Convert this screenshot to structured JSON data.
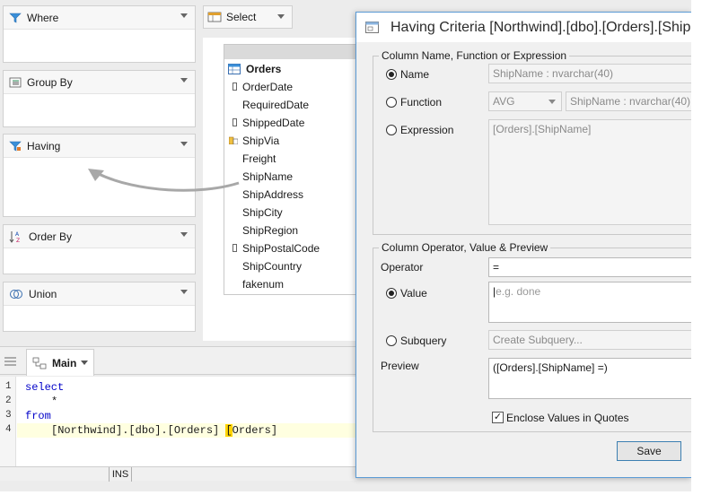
{
  "clauses": {
    "where": "Where",
    "group_by": "Group By",
    "having": "Having",
    "order_by": "Order By",
    "union": "Union"
  },
  "select_bar": {
    "label": "Select"
  },
  "table": {
    "name": "Orders",
    "columns": [
      "OrderDate",
      "RequiredDate",
      "ShippedDate",
      "ShipVia",
      "Freight",
      "ShipName",
      "ShipAddress",
      "ShipCity",
      "ShipRegion",
      "ShipPostalCode",
      "ShipCountry",
      "fakenum"
    ]
  },
  "editor": {
    "tab_label": "Main",
    "lines": [
      {
        "num": "1",
        "text": "select"
      },
      {
        "num": "2",
        "text": "*"
      },
      {
        "num": "3",
        "text": "from"
      },
      {
        "num": "4",
        "text": "[Northwind].[dbo].[Orders] ",
        "cursor_text": "[",
        "rest": "Orders]"
      }
    ],
    "status_ins": "INS"
  },
  "dialog": {
    "title": "Having Criteria [Northwind].[dbo].[Orders].[ShipName]",
    "group1_label": "Column Name, Function or Expression",
    "name_label": "Name",
    "name_value": "ShipName : nvarchar(40)",
    "function_label": "Function",
    "function_value": "AVG",
    "function_column": "ShipName : nvarchar(40)",
    "expression_label": "Expression",
    "expression_value": "[Orders].[ShipName]",
    "group2_label": "Column Operator, Value & Preview",
    "operator_label": "Operator",
    "operator_value": "=",
    "value_label": "Value",
    "value_placeholder": "e.g. done",
    "subquery_label": "Subquery",
    "subquery_value": "Create Subquery...",
    "preview_label": "Preview",
    "preview_value": "([Orders].[ShipName] =)",
    "enclose_label": "Enclose Values in Quotes",
    "save_label": "Save"
  },
  "colors": {
    "accent": "#5b9bd5",
    "keyword": "#0000c8",
    "arrow": "#a8a8a8"
  }
}
